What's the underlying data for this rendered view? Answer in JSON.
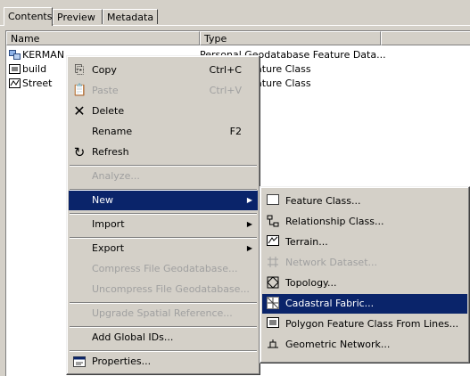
{
  "tabs": [
    "Contents",
    "Preview",
    "Metadata"
  ],
  "columns": {
    "name": "Name",
    "type": "Type"
  },
  "rows": [
    {
      "name": "KERMAN",
      "type": "Personal Geodatabase Feature Data...",
      "icon": "feature-dataset-icon"
    },
    {
      "name": "build",
      "type": "latabase Feature Class",
      "icon": "polygon-feature-class-icon"
    },
    {
      "name": "Street",
      "type": "latabase Feature Class",
      "icon": "line-feature-class-icon"
    }
  ],
  "context_menu": {
    "copy": {
      "label": "Copy",
      "shortcut": "Ctrl+C",
      "icon": "copy-icon"
    },
    "paste": {
      "label": "Paste",
      "shortcut": "Ctrl+V",
      "icon": "paste-icon"
    },
    "delete": {
      "label": "Delete",
      "icon": "delete-icon"
    },
    "rename": {
      "label": "Rename",
      "shortcut": "F2"
    },
    "refresh": {
      "label": "Refresh",
      "icon": "refresh-icon"
    },
    "analyze": {
      "label": "Analyze..."
    },
    "new": {
      "label": "New"
    },
    "import": {
      "label": "Import"
    },
    "export": {
      "label": "Export"
    },
    "compress": {
      "label": "Compress File Geodatabase..."
    },
    "uncompress": {
      "label": "Uncompress File Geodatabase..."
    },
    "upgrade": {
      "label": "Upgrade Spatial Reference..."
    },
    "add_global_ids": {
      "label": "Add Global IDs..."
    },
    "properties": {
      "label": "Properties...",
      "icon": "properties-icon"
    }
  },
  "submenu": {
    "feature_class": {
      "label": "Feature Class...",
      "icon": "feature-class-icon"
    },
    "relationship_class": {
      "label": "Relationship Class...",
      "icon": "relationship-class-icon"
    },
    "terrain": {
      "label": "Terrain...",
      "icon": "terrain-icon"
    },
    "network_dataset": {
      "label": "Network Dataset...",
      "icon": "network-dataset-icon"
    },
    "topology": {
      "label": "Topology...",
      "icon": "topology-icon"
    },
    "cadastral_fabric": {
      "label": "Cadastral Fabric...",
      "icon": "cadastral-fabric-icon"
    },
    "polygon_from_lines": {
      "label": "Polygon Feature Class From Lines...",
      "icon": "polygon-feature-class-icon"
    },
    "geometric_network": {
      "label": "Geometric Network...",
      "icon": "geometric-network-icon"
    }
  }
}
